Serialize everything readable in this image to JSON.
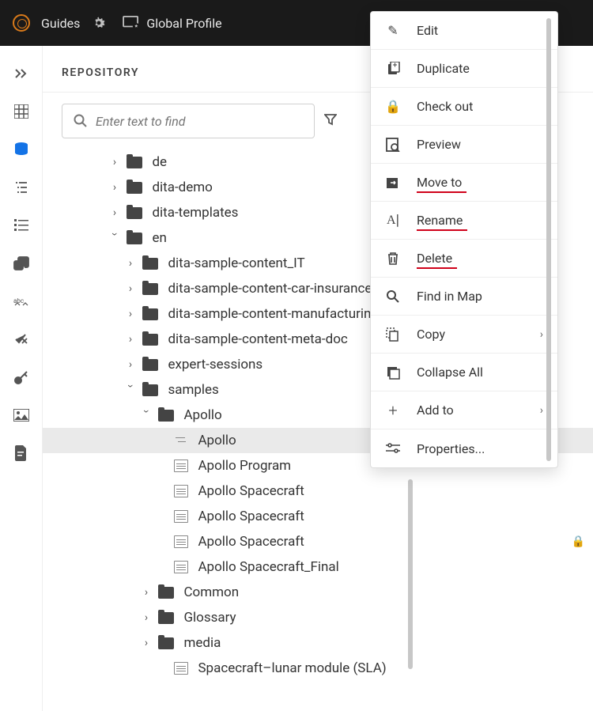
{
  "topbar": {
    "app_label": "Guides",
    "profile_label": "Global Profile"
  },
  "panel": {
    "title": "REPOSITORY",
    "search_placeholder": "Enter text to find"
  },
  "tree": {
    "de": "de",
    "dita_demo": "dita-demo",
    "dita_templates": "dita-templates",
    "en": "en",
    "it": "dita-sample-content_IT",
    "car": "dita-sample-content-car-insurance",
    "mfg": "dita-sample-content-manufacturing-m",
    "meta": "dita-sample-content-meta-doc",
    "expert": "expert-sessions",
    "samples": "samples",
    "apollo_folder": "Apollo",
    "apollo_map": "Apollo",
    "apollo_program": "Apollo Program",
    "apollo_sc1": "Apollo Spacecraft",
    "apollo_sc2": "Apollo Spacecraft",
    "apollo_sc3": "Apollo Spacecraft",
    "apollo_sc_final": "Apollo Spacecraft_Final",
    "common": "Common",
    "glossary": "Glossary",
    "media": "media",
    "sla": "Spacecraft–lunar module (SLA)"
  },
  "context_menu": {
    "edit": "Edit",
    "duplicate": "Duplicate",
    "check_out": "Check out",
    "preview": "Preview",
    "move_to": "Move to",
    "rename": "Rename",
    "delete": "Delete",
    "find_in_map": "Find in Map",
    "copy": "Copy",
    "collapse_all": "Collapse All",
    "add_to": "Add to",
    "properties": "Properties..."
  }
}
